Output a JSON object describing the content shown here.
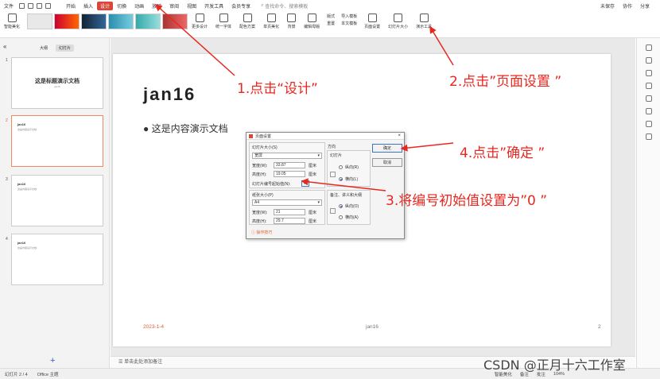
{
  "menubar": {
    "file": "文件",
    "items": [
      "开始",
      "插入",
      "设计",
      "切换",
      "动画",
      "放映",
      "审阅",
      "视图",
      "开发工具",
      "会员专享"
    ],
    "active_index": 2,
    "search": "查找命令、搜索模板",
    "unsaved": "未保存",
    "collab": "协作",
    "share": "分享"
  },
  "ribbon": {
    "smart": "智能美化",
    "more": "更多设计",
    "font": "统一字体",
    "scheme": "配色方案",
    "single": "单页美化",
    "bg": "背景",
    "master": "编辑母版",
    "layout": "版式",
    "reset": "重置",
    "import": "导入模板",
    "text_tpl": "本文模板",
    "page_setup": "页面设置",
    "slide_size": "幻灯片大小",
    "presenter": "演示工具"
  },
  "left": {
    "tab_outline": "大纲",
    "tab_slides": "幻灯片",
    "slides": [
      {
        "num": "1",
        "title": "这是标题演示文档",
        "sub": "jan16"
      },
      {
        "num": "2",
        "title": "jan16",
        "sub": "这是内容演示文档"
      },
      {
        "num": "3",
        "title": "jan16",
        "sub": "这是内容演示文档"
      },
      {
        "num": "4",
        "title": "jan16",
        "sub": "这是内容演示文档"
      }
    ],
    "add": "+"
  },
  "slide": {
    "title": "jan16",
    "bullet": "● 这是内容演示文档",
    "date": "2023-1-4",
    "footer": "jan16",
    "page": "2"
  },
  "notes": "单击此处添加备注",
  "status": {
    "slide": "幻灯片 2 / 4",
    "theme": "Office 主题",
    "smart": "智能美化",
    "notes": "备注",
    "comment": "批注",
    "zoom": "104%"
  },
  "dialog": {
    "title": "页面设置",
    "size_label": "幻灯片大小(S)",
    "size_value": "宽屏",
    "width_label": "宽度(W):",
    "width_value": "33.87",
    "height_label": "高度(H):",
    "height_value": "19.05",
    "unit": "厘米",
    "start_label": "幻灯片编号起始值(N):",
    "start_value": "0",
    "paper_label": "纸张大小(P)",
    "paper_value": "A4",
    "pw_value": "21",
    "ph_value": "29.7",
    "tips": "操作技巧",
    "orient": "方向",
    "slides": "幻灯片",
    "portrait": "纵向(R)",
    "landscape": "横向(L)",
    "notes_orient": "备注、讲义和大纲",
    "portrait2": "纵向(O)",
    "landscape2": "横向(A)",
    "ok": "确定",
    "cancel": "取消"
  },
  "annotations": {
    "a1": "1.点击“设计”",
    "a2": "2.点击”页面设置 ”",
    "a3": "3.将编号初始值设置为”0 ”",
    "a4": "4.点击”确定 ”"
  },
  "watermark": "CSDN @正月十六工作室"
}
